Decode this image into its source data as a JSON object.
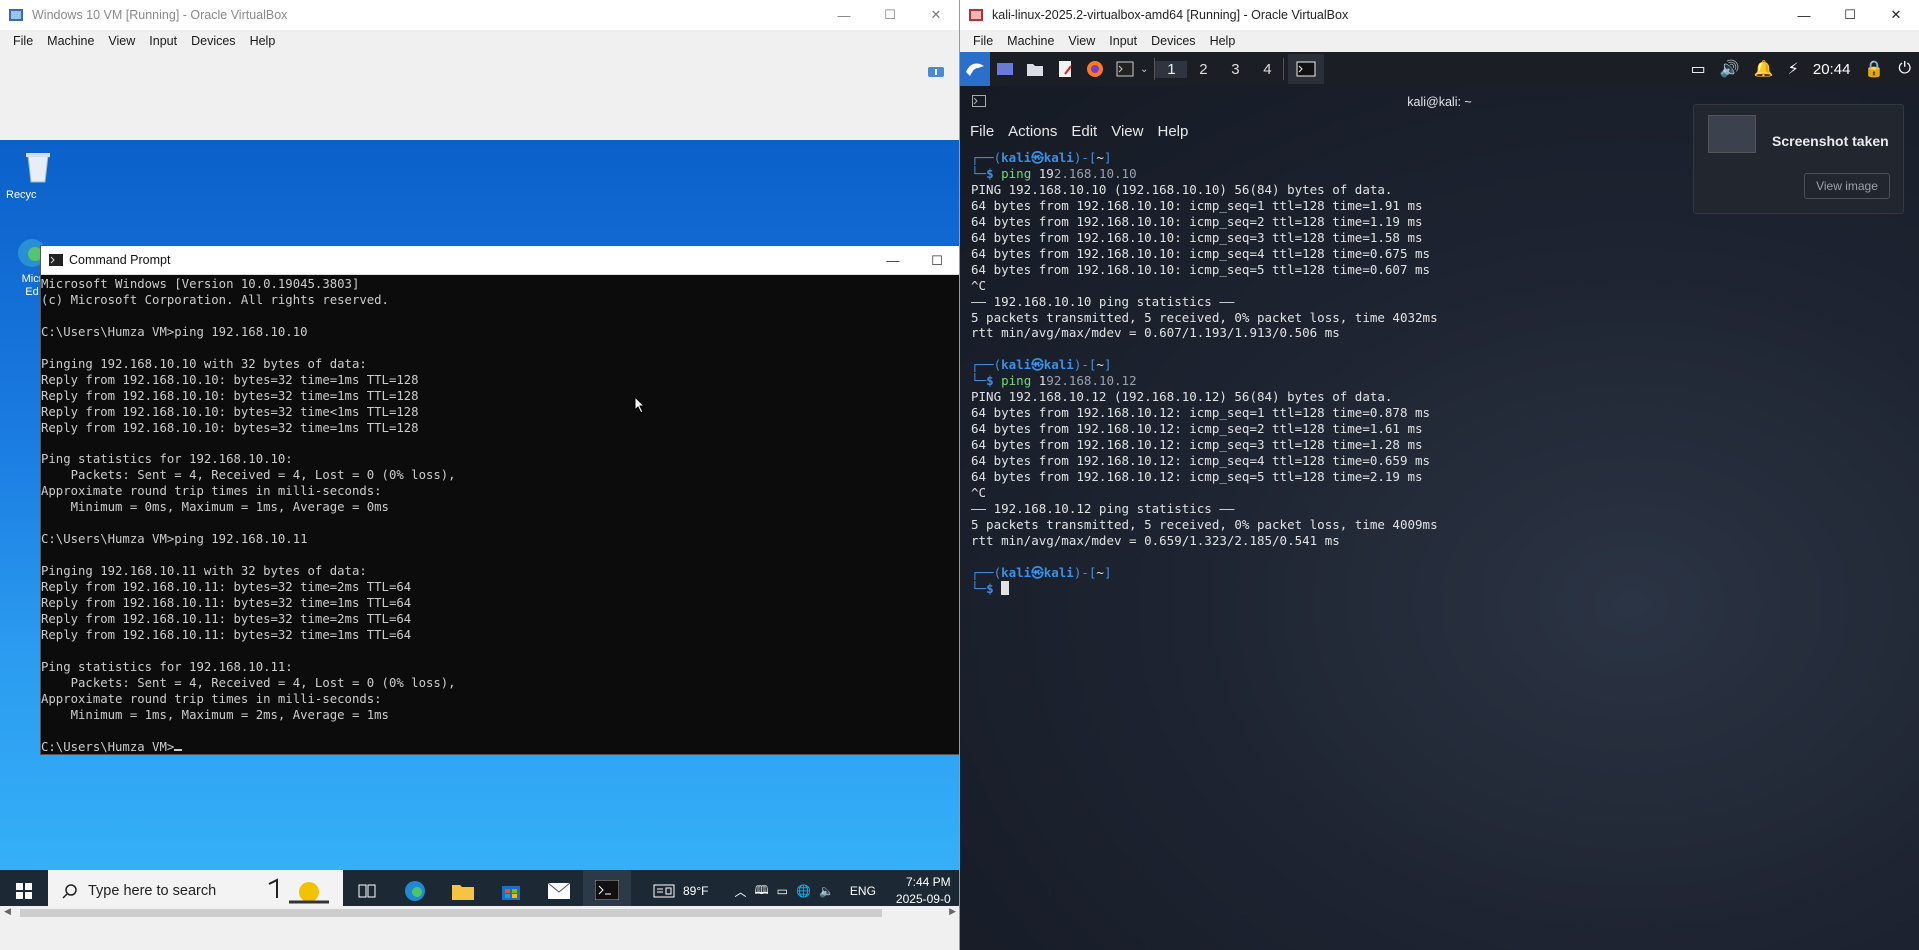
{
  "left_window": {
    "title": "Windows 10 VM [Running] - Oracle VirtualBox",
    "menu": [
      "File",
      "Machine",
      "View",
      "Input",
      "Devices",
      "Help"
    ],
    "desktop_icons": [
      "Recycle Bin",
      "Microsoft Edge"
    ],
    "recycle_label": "Recyc",
    "edge_label": "Micr\nEd",
    "cmd": {
      "title": "Command Prompt",
      "lines": [
        "Microsoft Windows [Version 10.0.19045.3803]",
        "(c) Microsoft Corporation. All rights reserved.",
        "",
        "C:\\Users\\Humza VM>ping 192.168.10.10",
        "",
        "Pinging 192.168.10.10 with 32 bytes of data:",
        "Reply from 192.168.10.10: bytes=32 time=1ms TTL=128",
        "Reply from 192.168.10.10: bytes=32 time=1ms TTL=128",
        "Reply from 192.168.10.10: bytes=32 time<1ms TTL=128",
        "Reply from 192.168.10.10: bytes=32 time=1ms TTL=128",
        "",
        "Ping statistics for 192.168.10.10:",
        "    Packets: Sent = 4, Received = 4, Lost = 0 (0% loss),",
        "Approximate round trip times in milli-seconds:",
        "    Minimum = 0ms, Maximum = 1ms, Average = 0ms",
        "",
        "C:\\Users\\Humza VM>ping 192.168.10.11",
        "",
        "Pinging 192.168.10.11 with 32 bytes of data:",
        "Reply from 192.168.10.11: bytes=32 time=2ms TTL=64",
        "Reply from 192.168.10.11: bytes=32 time=1ms TTL=64",
        "Reply from 192.168.10.11: bytes=32 time=2ms TTL=64",
        "Reply from 192.168.10.11: bytes=32 time=1ms TTL=64",
        "",
        "Ping statistics for 192.168.10.11:",
        "    Packets: Sent = 4, Received = 4, Lost = 0 (0% loss),",
        "Approximate round trip times in milli-seconds:",
        "    Minimum = 1ms, Maximum = 2ms, Average = 1ms",
        "",
        "C:\\Users\\Humza VM>"
      ]
    },
    "taskbar": {
      "search_placeholder": "Type here to search",
      "weather": "89°F",
      "lang": "ENG",
      "time": "7:44 PM",
      "date": "2025-09-0"
    }
  },
  "right_window": {
    "title": "kali-linux-2025.2-virtualbox-amd64 [Running] - Oracle VirtualBox",
    "menu": [
      "File",
      "Machine",
      "View",
      "Input",
      "Devices",
      "Help"
    ],
    "panel": {
      "workspaces": [
        "1",
        "2",
        "3",
        "4"
      ],
      "clock": "20:44"
    },
    "terminal": {
      "title": "kali@kali: ~",
      "menu": [
        "File",
        "Actions",
        "Edit",
        "View",
        "Help"
      ],
      "prompt_user": "kali",
      "prompt_host": "kali",
      "prompt_dir": "~",
      "blocks": [
        {
          "cmd": "ping",
          "arg_typed": "19",
          "arg_rest": "2.168.10.10",
          "output": [
            "PING 192.168.10.10 (192.168.10.10) 56(84) bytes of data.",
            "64 bytes from 192.168.10.10: icmp_seq=1 ttl=128 time=1.91 ms",
            "64 bytes from 192.168.10.10: icmp_seq=2 ttl=128 time=1.19 ms",
            "64 bytes from 192.168.10.10: icmp_seq=3 ttl=128 time=1.58 ms",
            "64 bytes from 192.168.10.10: icmp_seq=4 ttl=128 time=0.675 ms",
            "64 bytes from 192.168.10.10: icmp_seq=5 ttl=128 time=0.607 ms",
            "^C",
            "—— 192.168.10.10 ping statistics ——",
            "5 packets transmitted, 5 received, 0% packet loss, time 4032ms",
            "rtt min/avg/max/mdev = 0.607/1.193/1.913/0.506 ms"
          ]
        },
        {
          "cmd": "ping",
          "arg_typed": "1",
          "arg_rest": "92.168.10.12",
          "output": [
            "PING 192.168.10.12 (192.168.10.12) 56(84) bytes of data.",
            "64 bytes from 192.168.10.12: icmp_seq=1 ttl=128 time=0.878 ms",
            "64 bytes from 192.168.10.12: icmp_seq=2 ttl=128 time=1.61 ms",
            "64 bytes from 192.168.10.12: icmp_seq=3 ttl=128 time=1.28 ms",
            "64 bytes from 192.168.10.12: icmp_seq=4 ttl=128 time=0.659 ms",
            "64 bytes from 192.168.10.12: icmp_seq=5 ttl=128 time=2.19 ms",
            "^C",
            "—— 192.168.10.12 ping statistics ——",
            "5 packets transmitted, 5 received, 0% packet loss, time 4009ms",
            "rtt min/avg/max/mdev = 0.659/1.323/2.185/0.541 ms"
          ]
        }
      ]
    },
    "notification": {
      "title": "Screenshot taken",
      "button": "View image"
    }
  }
}
